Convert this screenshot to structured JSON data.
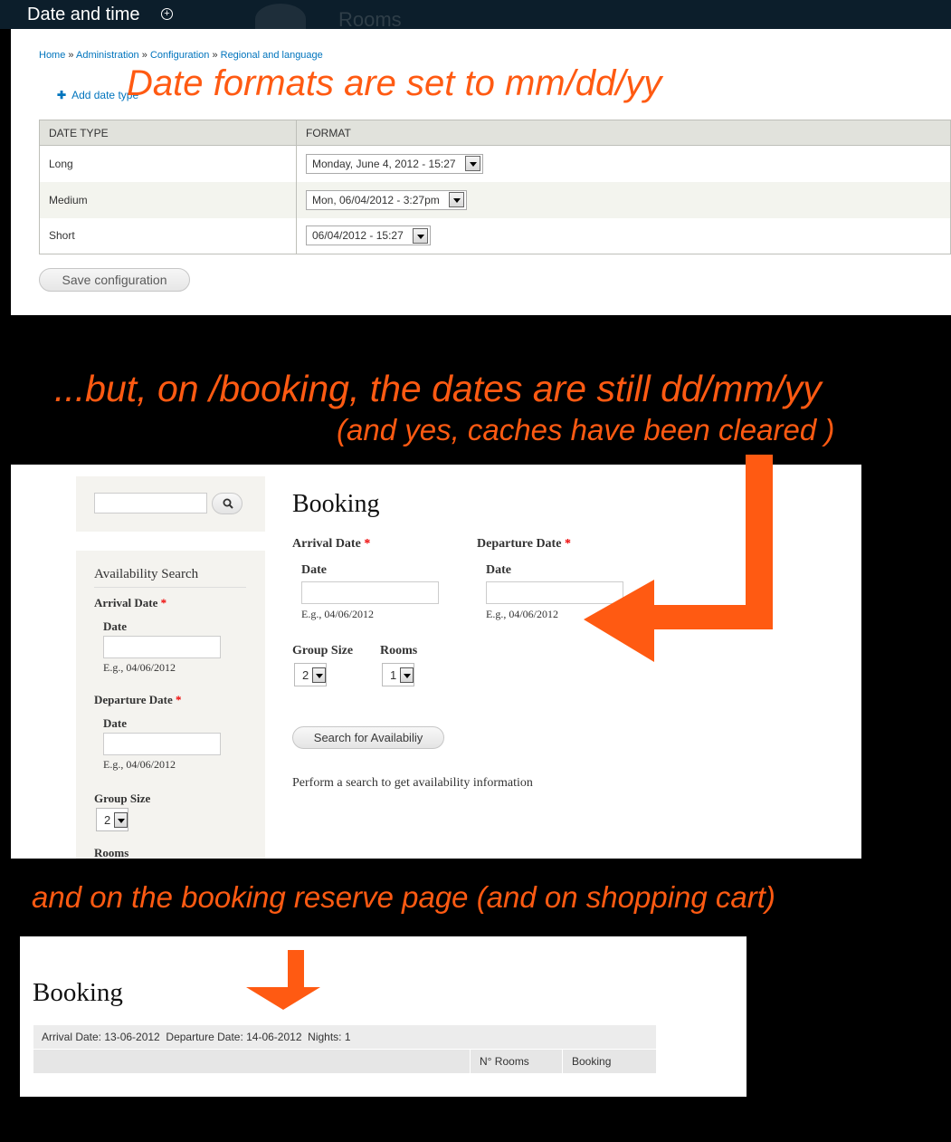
{
  "admin": {
    "header_title": "Date and time",
    "ghost_tab": "Rooms",
    "breadcrumbs": [
      "Home",
      "Administration",
      "Configuration",
      "Regional and language"
    ],
    "breadcrumb_separator": "»",
    "add_date_type": "Add date type",
    "table_headers": [
      "Date type",
      "Format"
    ],
    "rows": [
      {
        "type": "Long",
        "format": "Monday, June 4, 2012 - 15:27"
      },
      {
        "type": "Medium",
        "format": "Mon, 06/04/2012 - 3:27pm"
      },
      {
        "type": "Short",
        "format": "06/04/2012 - 15:27"
      }
    ],
    "save_label": "Save configuration"
  },
  "annotations": {
    "first": "Date formats are set to mm/dd/yy",
    "second": "...but, on /booking, the dates are still dd/mm/yy",
    "third": "(and yes, caches have been cleared )",
    "fourth": "and on the booking reserve page (and on shopping cart)",
    "color": "#ff5a12"
  },
  "booking": {
    "sidebar": {
      "title": "Availability Search",
      "arrival_label": "Arrival Date",
      "date_label": "Date",
      "example": "E.g., 04/06/2012",
      "departure_label": "Departure Date",
      "group_size_label": "Group Size",
      "group_size_value": "2",
      "rooms_label": "Rooms"
    },
    "main": {
      "title": "Booking",
      "arrival_label": "Arrival Date",
      "departure_label": "Departure Date",
      "date_label": "Date",
      "example": "E.g., 04/06/2012",
      "group_size_label": "Group Size",
      "group_size_value": "2",
      "rooms_label": "Rooms",
      "rooms_value": "1",
      "search_button": "Search for Availabiliy",
      "info": "Perform a search to get availability information"
    }
  },
  "reserve": {
    "title": "Booking",
    "summary": "Arrival Date: 13-06-2012  Departure Date: 14-06-2012  Nights: 1",
    "columns": [
      "N° Rooms",
      "Booking"
    ]
  }
}
